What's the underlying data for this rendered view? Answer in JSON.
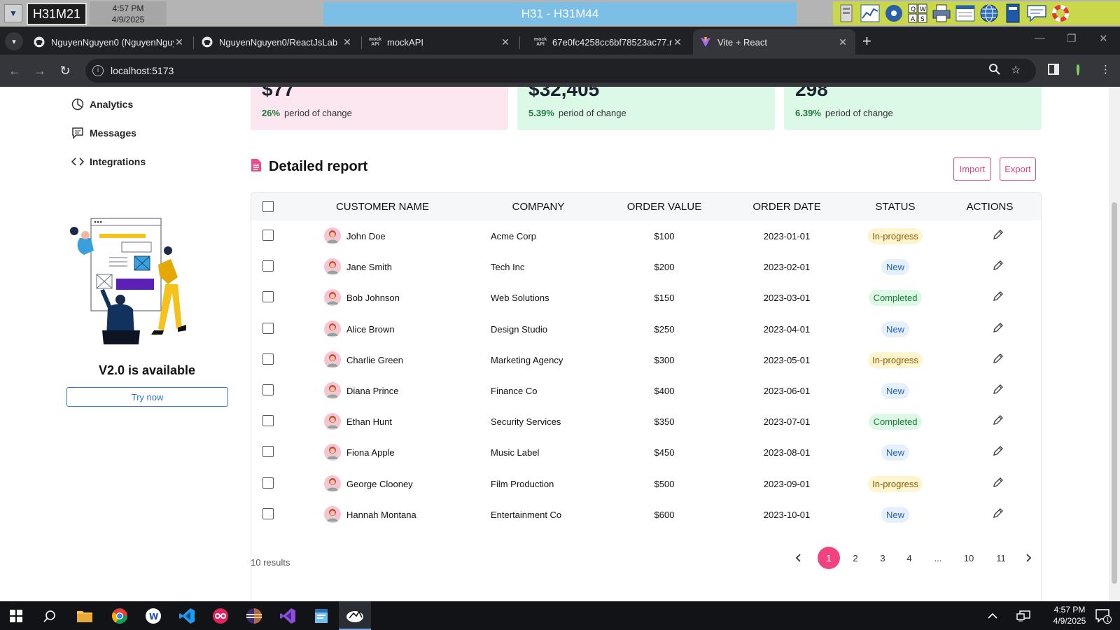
{
  "remote_bar": {
    "host": "H31M21",
    "time": "4:57 PM",
    "date": "4/9/2025",
    "session": "H31 - H31M44"
  },
  "browser": {
    "tabs": [
      {
        "label": "NguyenNguyen0 (NguyenNguy",
        "icon": "github-icon"
      },
      {
        "label": "NguyenNguyen0/ReactJsLab",
        "icon": "github-icon"
      },
      {
        "label": "mockAPI",
        "icon": "mockapi-icon"
      },
      {
        "label": "67e0fc4258cc6bf78523ac77.m",
        "icon": "mockapi-icon"
      },
      {
        "label": "Vite + React",
        "icon": "vite-icon",
        "active": true
      }
    ],
    "url": "localhost:5173"
  },
  "sidebar": {
    "items": [
      {
        "label": "Analytics",
        "icon": "chart-pie-icon"
      },
      {
        "label": "Messages",
        "icon": "message-icon"
      },
      {
        "label": "Integrations",
        "icon": "code-icon"
      }
    ],
    "promo": {
      "title": "V2.0 is available",
      "button": "Try now"
    }
  },
  "stats": [
    {
      "value": "$77",
      "change": "26%",
      "change_label": "period of change",
      "bg": "#fce7f1"
    },
    {
      "value": "$32,405",
      "change": "5.39%",
      "change_label": "period of change",
      "bg": "#dcf9e8"
    },
    {
      "value": "298",
      "change": "6.39%",
      "change_label": "period of change",
      "bg": "#dcf9e8"
    }
  ],
  "report": {
    "title": "Detailed report",
    "import_label": "Import",
    "export_label": "Export",
    "columns": [
      "CUSTOMER NAME",
      "COMPANY",
      "ORDER VALUE",
      "ORDER DATE",
      "STATUS",
      "ACTIONS"
    ],
    "rows": [
      {
        "name": "John Doe",
        "company": "Acme Corp",
        "value": "$100",
        "date": "2023-01-01",
        "status": "In-progress"
      },
      {
        "name": "Jane Smith",
        "company": "Tech Inc",
        "value": "$200",
        "date": "2023-02-01",
        "status": "New"
      },
      {
        "name": "Bob Johnson",
        "company": "Web Solutions",
        "value": "$150",
        "date": "2023-03-01",
        "status": "Completed"
      },
      {
        "name": "Alice Brown",
        "company": "Design Studio",
        "value": "$250",
        "date": "2023-04-01",
        "status": "New"
      },
      {
        "name": "Charlie Green",
        "company": "Marketing Agency",
        "value": "$300",
        "date": "2023-05-01",
        "status": "In-progress"
      },
      {
        "name": "Diana Prince",
        "company": "Finance Co",
        "value": "$400",
        "date": "2023-06-01",
        "status": "New"
      },
      {
        "name": "Ethan Hunt",
        "company": "Security Services",
        "value": "$350",
        "date": "2023-07-01",
        "status": "Completed"
      },
      {
        "name": "Fiona Apple",
        "company": "Music Label",
        "value": "$450",
        "date": "2023-08-01",
        "status": "New"
      },
      {
        "name": "George Clooney",
        "company": "Film Production",
        "value": "$500",
        "date": "2023-09-01",
        "status": "In-progress"
      },
      {
        "name": "Hannah Montana",
        "company": "Entertainment Co",
        "value": "$600",
        "date": "2023-10-01",
        "status": "New"
      }
    ],
    "status_colors": {
      "In-progress": {
        "bg": "#fdf5cf",
        "fg": "#8a5a00"
      },
      "New": {
        "bg": "#e6f0fd",
        "fg": "#1f5fbf"
      },
      "Completed": {
        "bg": "#def8e6",
        "fg": "#167a3a"
      }
    },
    "results_text": "10 results",
    "pages": [
      "1",
      "2",
      "3",
      "4",
      "...",
      "10",
      "11"
    ],
    "current_page": "1"
  },
  "taskbar": {
    "time": "4:57 PM",
    "date": "4/9/2025",
    "notification_count": "1"
  }
}
